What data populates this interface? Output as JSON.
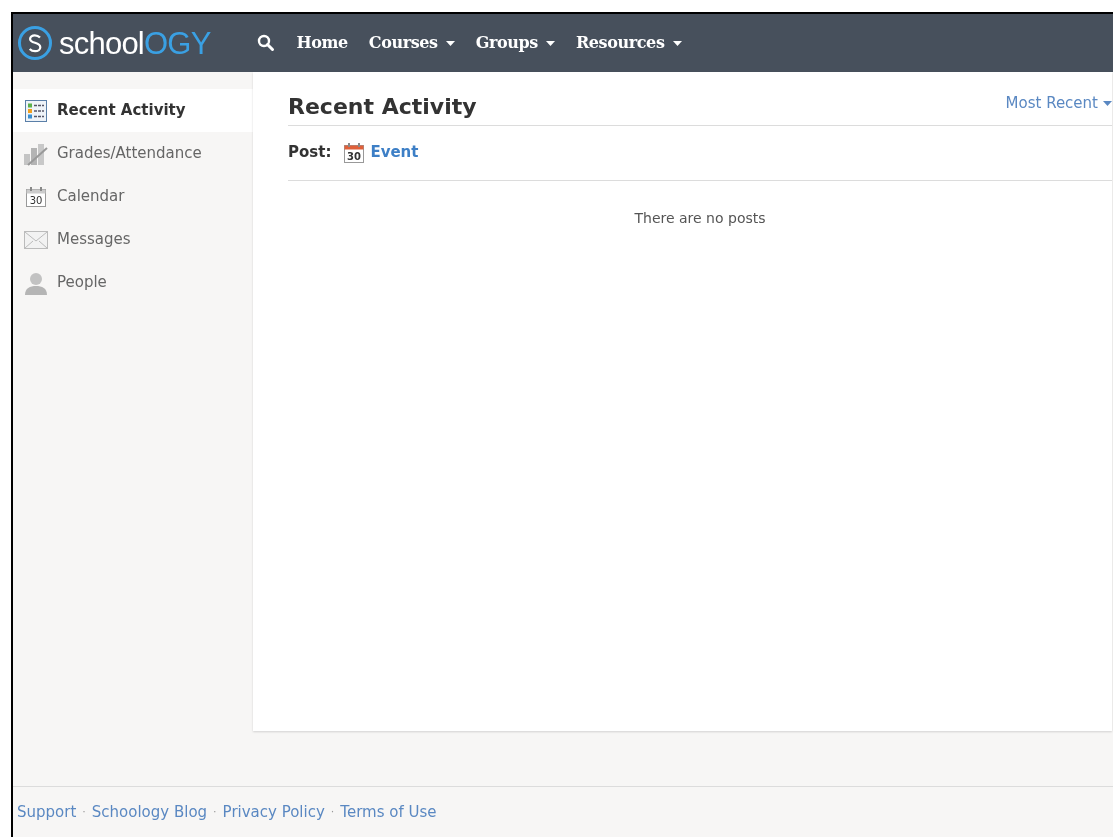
{
  "logo": {
    "text_main": "school",
    "text_accent": "OGY"
  },
  "nav": [
    {
      "label": "Home",
      "dropdown": false
    },
    {
      "label": "Courses",
      "dropdown": true
    },
    {
      "label": "Groups",
      "dropdown": true
    },
    {
      "label": "Resources",
      "dropdown": true
    }
  ],
  "sidebar": {
    "items": [
      {
        "label": "Recent Activity",
        "kind": "activity",
        "selected": true
      },
      {
        "label": "Grades/Attendance",
        "kind": "grades",
        "selected": false
      },
      {
        "label": "Calendar",
        "kind": "calendar",
        "selected": false
      },
      {
        "label": "Messages",
        "kind": "messages",
        "selected": false
      },
      {
        "label": "People",
        "kind": "people",
        "selected": false
      }
    ]
  },
  "main": {
    "title": "Recent Activity",
    "sort": "Most Recent",
    "post_label": "Post:",
    "post_options": [
      {
        "label": "Event",
        "calendar_day": "30"
      }
    ],
    "empty_message": "There are no posts"
  },
  "sidebar_calendar_day": "30",
  "footer": {
    "separator": "·",
    "links": [
      "Support",
      "Schoology Blog",
      "Privacy Policy",
      "Terms of Use"
    ]
  }
}
